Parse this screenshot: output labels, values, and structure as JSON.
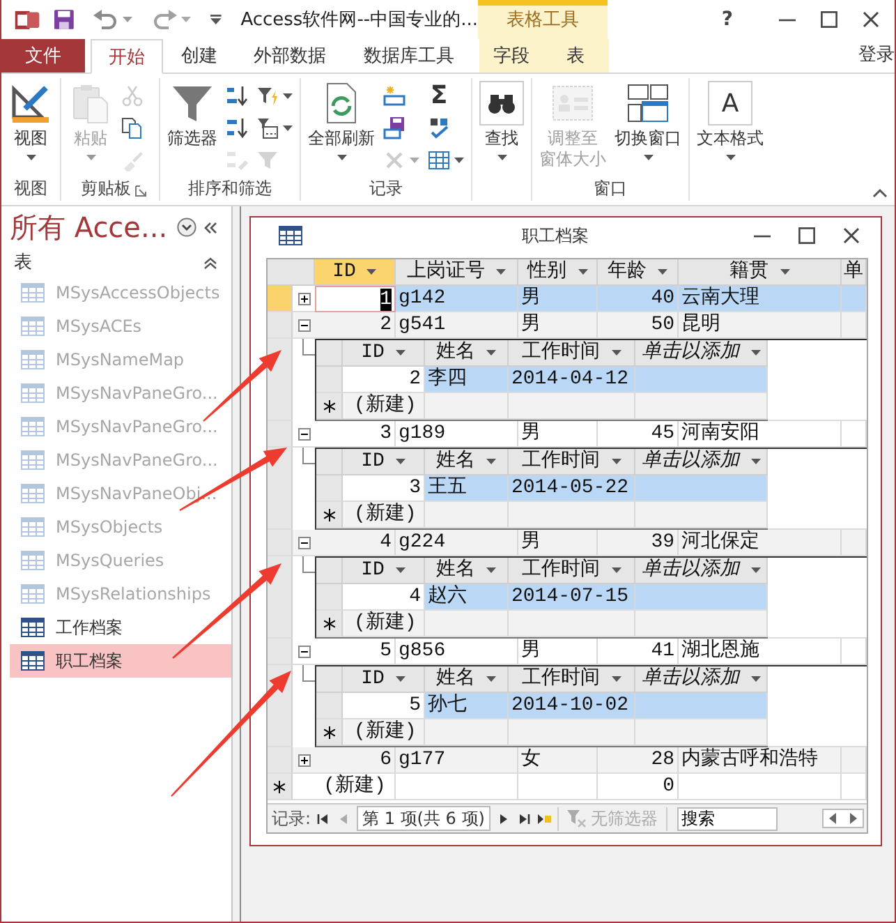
{
  "title_bar": {
    "title": "Access软件网--中国专业的...",
    "context_group": "表格工具",
    "help": "?"
  },
  "ribbon_tabs": [
    {
      "label": "文件",
      "kind": "file",
      "selected": false
    },
    {
      "label": "开始",
      "kind": "tab",
      "selected": true
    },
    {
      "label": "创建",
      "kind": "tab",
      "selected": false
    },
    {
      "label": "外部数据",
      "kind": "tab",
      "selected": false
    },
    {
      "label": "数据库工具",
      "kind": "tab",
      "selected": false
    },
    {
      "label": "字段",
      "kind": "context",
      "selected": false
    },
    {
      "label": "表",
      "kind": "context",
      "selected": false
    }
  ],
  "sign_in": "登录",
  "ribbon_groups": [
    {
      "label": "视图",
      "items": [
        {
          "kind": "large",
          "label": "视图",
          "disabled": false,
          "dropdown": true
        }
      ]
    },
    {
      "label": "剪贴板",
      "launcher": true,
      "items": [
        {
          "kind": "large",
          "label": "粘贴",
          "disabled": true,
          "dropdown": true
        },
        {
          "kind": "stack",
          "buttons": [
            {
              "disabled": true,
              "dropdown": false
            },
            {
              "disabled": false,
              "dropdown": false
            },
            {
              "disabled": true,
              "dropdown": false
            }
          ]
        }
      ]
    },
    {
      "label": "排序和筛选",
      "items": [
        {
          "kind": "large",
          "label": "筛选器",
          "disabled": false,
          "dropdown": false
        },
        {
          "kind": "stack",
          "buttons": [
            {
              "disabled": false,
              "dropdown": false
            },
            {
              "disabled": false,
              "dropdown": false
            },
            {
              "disabled": true,
              "dropdown": false
            }
          ]
        },
        {
          "kind": "stack",
          "buttons": [
            {
              "disabled": false,
              "dropdown": true
            },
            {
              "disabled": false,
              "dropdown": true
            },
            {
              "disabled": true,
              "dropdown": false
            }
          ]
        }
      ]
    },
    {
      "label": "记录",
      "items": [
        {
          "kind": "large",
          "label": "全部刷新",
          "disabled": false,
          "dropdown": true
        },
        {
          "kind": "stack",
          "buttons": [
            {
              "disabled": false,
              "dropdown": false
            },
            {
              "disabled": false,
              "dropdown": false
            },
            {
              "disabled": true,
              "dropdown": true
            }
          ]
        },
        {
          "kind": "stack",
          "buttons": [
            {
              "disabled": false,
              "dropdown": false,
              "glyph": "Σ"
            },
            {
              "disabled": false,
              "dropdown": false
            },
            {
              "disabled": false,
              "dropdown": true
            }
          ]
        }
      ]
    },
    {
      "items": [
        {
          "kind": "large",
          "label": "查找",
          "disabled": false,
          "dropdown": true
        }
      ]
    },
    {
      "label": "窗口",
      "items": [
        {
          "kind": "large",
          "label_lines": [
            "调整至",
            "窗体大小"
          ],
          "disabled": true,
          "dropdown": false
        },
        {
          "kind": "large",
          "label": "切换窗口",
          "disabled": false,
          "dropdown": true
        }
      ]
    },
    {
      "items": [
        {
          "kind": "large",
          "label": "文本格式",
          "disabled": false,
          "dropdown": true,
          "glyph": "A"
        }
      ]
    }
  ],
  "nav_pane": {
    "title": "所有 Acce...",
    "section": "表",
    "items": [
      {
        "label": "MSysAccessObjects",
        "kind": "system",
        "selected": false
      },
      {
        "label": "MSysACEs",
        "kind": "system",
        "selected": false
      },
      {
        "label": "MSysNameMap",
        "kind": "system",
        "selected": false
      },
      {
        "label": "MSysNavPaneGro...",
        "kind": "system",
        "selected": false
      },
      {
        "label": "MSysNavPaneGro...",
        "kind": "system",
        "selected": false
      },
      {
        "label": "MSysNavPaneGro...",
        "kind": "system",
        "selected": false
      },
      {
        "label": "MSysNavPaneObj...",
        "kind": "system",
        "selected": false
      },
      {
        "label": "MSysObjects",
        "kind": "system",
        "selected": false
      },
      {
        "label": "MSysQueries",
        "kind": "system",
        "selected": false
      },
      {
        "label": "MSysRelationships",
        "kind": "system",
        "selected": false
      },
      {
        "label": "工作档案",
        "kind": "table",
        "selected": false
      },
      {
        "label": "职工档案",
        "kind": "table",
        "selected": true
      }
    ]
  },
  "document": {
    "title": "职工档案",
    "columns": [
      {
        "label": "ID",
        "kind": "number",
        "dropdown": true,
        "selected": true
      },
      {
        "label": "上岗证号",
        "kind": "text",
        "dropdown": true,
        "selected": false
      },
      {
        "label": "性别",
        "kind": "text",
        "dropdown": true,
        "selected": false
      },
      {
        "label": "年龄",
        "kind": "number",
        "dropdown": true,
        "selected": false
      },
      {
        "label": "籍贯",
        "kind": "text",
        "dropdown": true,
        "selected": false
      },
      {
        "label": "单",
        "kind": "text",
        "dropdown": false,
        "selected": false
      }
    ],
    "rows": [
      {
        "cells": [
          "1",
          "g142",
          "男",
          "40",
          "云南大理"
        ],
        "selected": true,
        "expanded": false
      },
      {
        "cells": [
          "2",
          "g541",
          "男",
          "50",
          "昆明"
        ],
        "selected": false,
        "expanded": true,
        "subdatasheet": {
          "columns": [
            {
              "label": "ID",
              "kind": "number"
            },
            {
              "label": "姓名",
              "kind": "text"
            },
            {
              "label": "工作时间",
              "kind": "text"
            },
            {
              "label": "单击以添加",
              "kind": "add"
            }
          ],
          "rows": [
            {
              "cells": [
                "2",
                "李四",
                "2014-04-12"
              ],
              "selected": true
            }
          ],
          "new_row": "(新建)"
        }
      },
      {
        "cells": [
          "3",
          "g189",
          "男",
          "45",
          "河南安阳"
        ],
        "selected": false,
        "expanded": true,
        "subdatasheet": {
          "columns": [
            {
              "label": "ID",
              "kind": "number"
            },
            {
              "label": "姓名",
              "kind": "text"
            },
            {
              "label": "工作时间",
              "kind": "text"
            },
            {
              "label": "单击以添加",
              "kind": "add"
            }
          ],
          "rows": [
            {
              "cells": [
                "3",
                "王五",
                "2014-05-22"
              ],
              "selected": true
            }
          ],
          "new_row": "(新建)"
        }
      },
      {
        "cells": [
          "4",
          "g224",
          "男",
          "39",
          "河北保定"
        ],
        "selected": false,
        "expanded": true,
        "subdatasheet": {
          "columns": [
            {
              "label": "ID",
              "kind": "number"
            },
            {
              "label": "姓名",
              "kind": "text"
            },
            {
              "label": "工作时间",
              "kind": "text"
            },
            {
              "label": "单击以添加",
              "kind": "add"
            }
          ],
          "rows": [
            {
              "cells": [
                "4",
                "赵六",
                "2014-07-15"
              ],
              "selected": true
            }
          ],
          "new_row": "(新建)"
        }
      },
      {
        "cells": [
          "5",
          "g856",
          "男",
          "41",
          "湖北恩施"
        ],
        "selected": false,
        "expanded": true,
        "subdatasheet": {
          "columns": [
            {
              "label": "ID",
              "kind": "number"
            },
            {
              "label": "姓名",
              "kind": "text"
            },
            {
              "label": "工作时间",
              "kind": "text"
            },
            {
              "label": "单击以添加",
              "kind": "add"
            }
          ],
          "rows": [
            {
              "cells": [
                "5",
                "孙七",
                "2014-10-02"
              ],
              "selected": true
            }
          ],
          "new_row": "(新建)"
        }
      },
      {
        "cells": [
          "6",
          "g177",
          "女",
          "28",
          "内蒙古呼和浩特"
        ],
        "selected": false,
        "expanded": false
      }
    ],
    "new_row": {
      "label": "(新建)",
      "age": "0"
    },
    "record_bar": {
      "label": "记录:",
      "position": "第 1 项(共 6 项)",
      "filter": "无筛选器",
      "filter_active": false,
      "search_placeholder": "搜索"
    }
  },
  "overlay_arrows": [
    {
      "kind": "arrow"
    },
    {
      "kind": "arrow"
    },
    {
      "kind": "arrow"
    },
    {
      "kind": "arrow"
    }
  ]
}
